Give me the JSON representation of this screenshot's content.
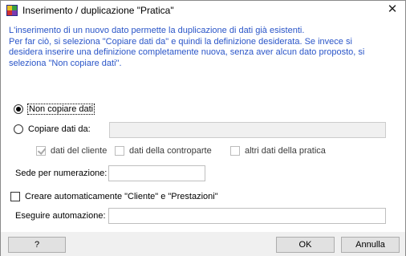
{
  "window": {
    "title": "Inserimento / duplicazione \"Pratica\"",
    "close_glyph": "✕",
    "icon": "app-icon"
  },
  "info_lines": [
    "L'inserimento di un nuovo dato permette la duplicazione di dati già esistenti.",
    "Per far ciò, si seleziona \"Copiare dati da\" e quindi la definizione desiderata. Se invece si",
    "desidera inserire una definizione completamente nuova, senza aver alcun dato proposto, si",
    "seleziona \"Non copiare dati\"."
  ],
  "options": {
    "non_copiare": {
      "label": "Non copiare dati",
      "selected": true
    },
    "copiare": {
      "label": "Copiare dati da:",
      "selected": false,
      "value": ""
    }
  },
  "copy_checks": [
    {
      "label": "dati del cliente",
      "checked": true
    },
    {
      "label": "dati della controparte",
      "checked": false
    },
    {
      "label": "altri dati della pratica",
      "checked": false
    }
  ],
  "sede": {
    "label": "Sede per numerazione:",
    "value": ""
  },
  "auto": {
    "label": "Creare automaticamente \"Cliente\" e \"Prestazioni\"",
    "checked": false
  },
  "eseguire": {
    "label": "Eseguire automazione:",
    "value": ""
  },
  "buttons": {
    "help": "?",
    "ok": "OK",
    "cancel": "Annulla"
  },
  "colors": {
    "info_text": "#2a55c8",
    "footer_bg": "#f0f0f0",
    "button_bg": "#e1e1e1"
  }
}
